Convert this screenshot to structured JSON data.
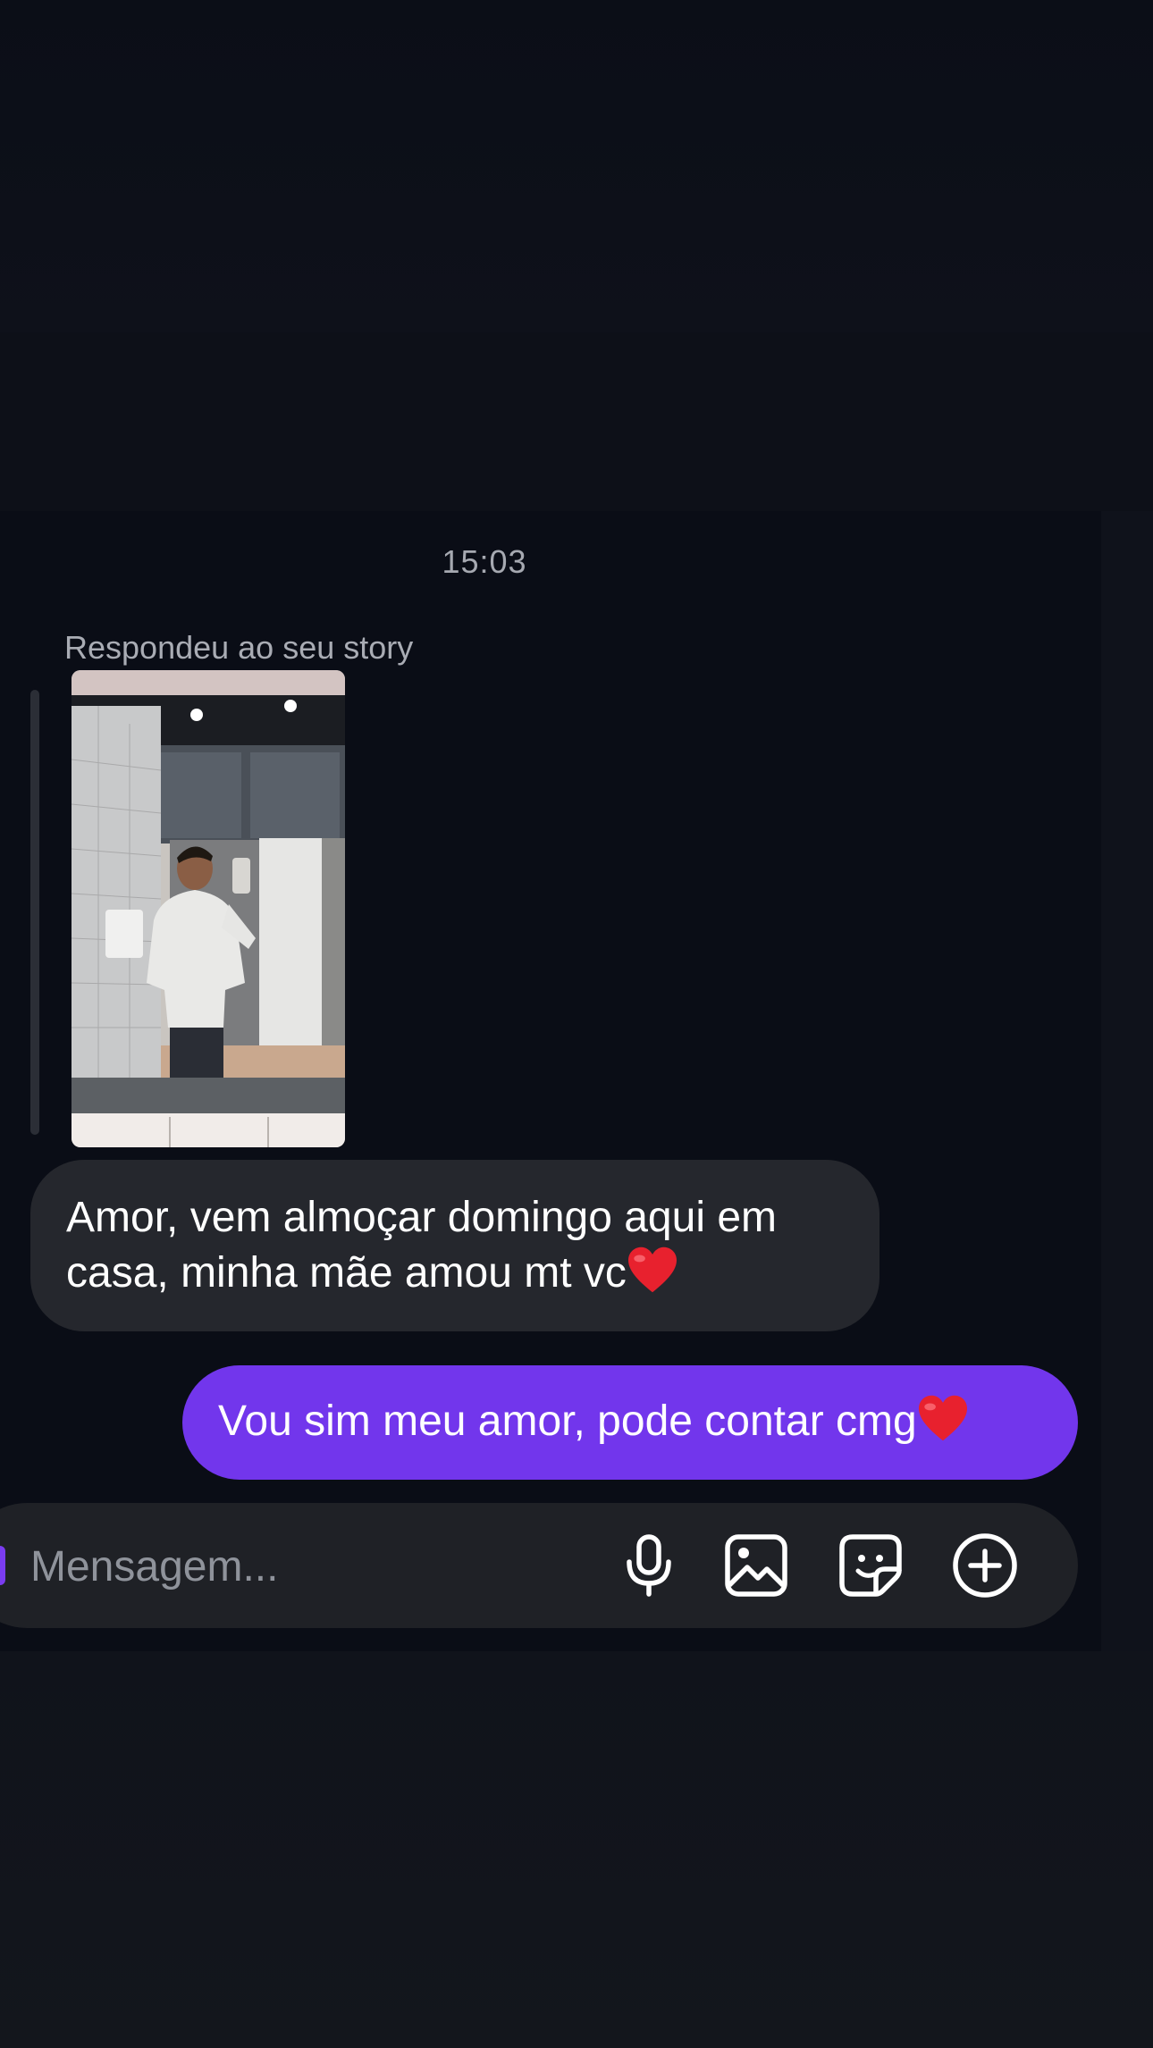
{
  "conversation": {
    "timestamp": "15:03",
    "reply_label": "Respondeu ao seu story"
  },
  "messages": {
    "received_1": {
      "line_1": "Amor, vem almoçar domingo aqui em",
      "line_2": "casa, minha mãe amou mt vc",
      "emoji": "red-heart"
    },
    "sent_1": {
      "text": "Vou sim meu amor, pode contar cmg",
      "emoji": "red-heart"
    }
  },
  "composer": {
    "placeholder": "Mensagem...",
    "buttons": [
      "microphone-icon",
      "gallery-icon",
      "sticker-icon",
      "plus-circle-icon"
    ]
  },
  "colors": {
    "background": "#0a0d16",
    "received_bubble": "#25272d",
    "sent_bubble": "#7236ec",
    "composer": "#1f2126",
    "accent": "#7a3cf0",
    "heart": "#e8212e"
  }
}
